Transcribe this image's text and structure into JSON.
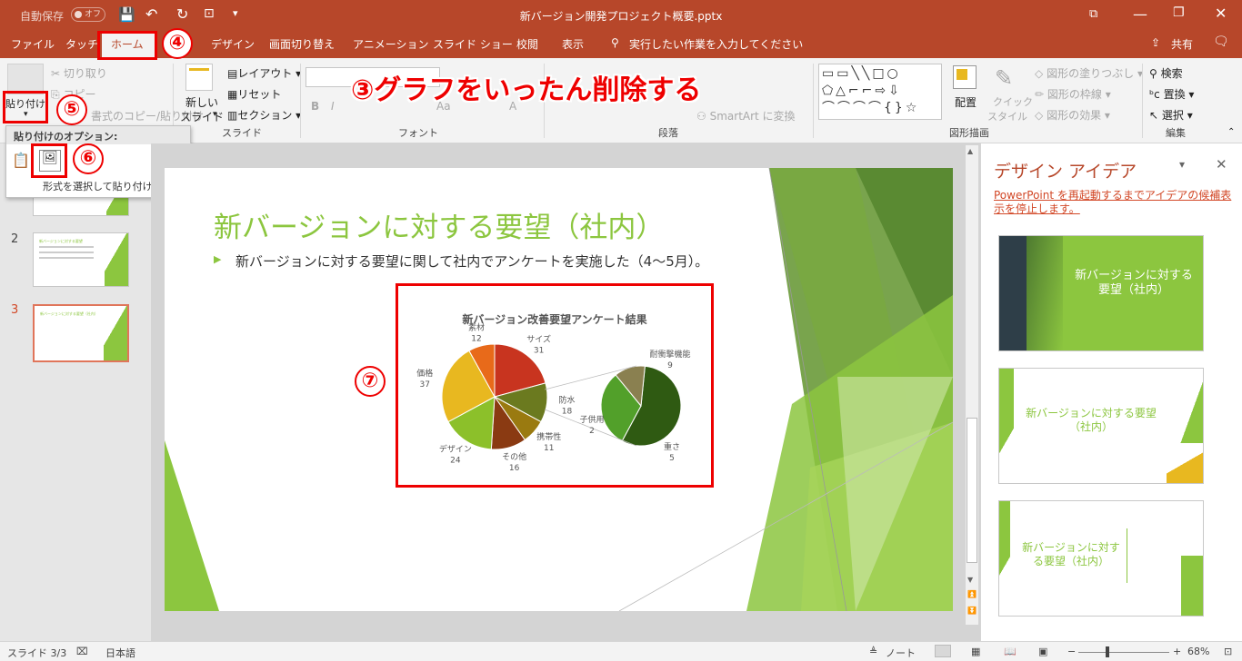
{
  "titlebar": {
    "autosave_label": "自動保存",
    "autosave_state": "オフ",
    "document_title": "新バージョン開発プロジェクト概要.pptx"
  },
  "menu": {
    "tabs": [
      "ファイル",
      "タッチ",
      "ホーム",
      "デザイン",
      "画面切り替え",
      "アニメーション",
      "スライド ショー",
      "校閲",
      "表示"
    ],
    "search_placeholder": "実行したい作業を入力してください",
    "share": "共有"
  },
  "ribbon": {
    "cut": "切り取り",
    "copy": "コピー",
    "format_painter": "書式のコピー/貼り付け",
    "paste": "貼り付け",
    "new_slide_line1": "新しい",
    "new_slide_line2": "スライド",
    "layout": "レイアウト",
    "reset": "リセット",
    "section": "セクション",
    "group_slides": "スライド",
    "group_font": "フォント",
    "group_paragraph": "段落",
    "group_drawing": "図形描画",
    "group_edit": "編集",
    "font_bold": "B",
    "font_italic": "I",
    "font_aa": "Aa",
    "font_a": "A",
    "smartart": "SmartArt に変換",
    "arrange": "配置",
    "quick_style_line1": "クイック",
    "quick_style_line2": "スタイル",
    "shape_fill": "図形の塗りつぶし",
    "shape_outline": "図形の枠線",
    "shape_effect": "図形の効果",
    "find": "検索",
    "replace": "置換",
    "select": "選択"
  },
  "paste_popup": {
    "title": "貼り付けのオプション:",
    "special": "形式を選択して貼り付け(S)..."
  },
  "annotations": {
    "step3": "③グラフをいったん削除する",
    "step4": "④",
    "step5": "⑤",
    "step6": "⑥",
    "step7": "⑦"
  },
  "thumbnails": [
    {
      "num": "2",
      "title": "新バージョンに対する要望"
    },
    {
      "num": "3",
      "title": "新バージョンに対する要望（社内）"
    }
  ],
  "slide": {
    "title": "新バージョンに対する要望（社内）",
    "bullet": "新バージョンに対する要望に関して社内でアンケートを実施した（4〜5月）。"
  },
  "chart_data": {
    "type": "pie",
    "title": "新バージョン改善要望アンケート結果",
    "categories": [
      "サイズ",
      "防水",
      "携帯性",
      "その他",
      "デザイン",
      "価格",
      "素材"
    ],
    "values": [
      31,
      18,
      11,
      16,
      24,
      37,
      12
    ],
    "colors": [
      "#c8341f",
      "#6b7a1f",
      "#9a7a10",
      "#8a3a12",
      "#8cc02a",
      "#e8b820",
      "#e86a1a"
    ],
    "sub_categories": [
      "耐衝撃機能",
      "重さ",
      "子供用"
    ],
    "sub_values": [
      9,
      5,
      2
    ],
    "sub_colors": [
      "#2f5a12",
      "#52a02a",
      "#8a8050"
    ]
  },
  "design_pane": {
    "title": "デザイン アイデア",
    "notice": "PowerPoint を再起動するまでアイデアの候補表示を停止します。",
    "idea1_title": "新バージョンに対する要望（社内）",
    "idea2_title": "新バージョンに対する要望（社内）",
    "idea3_title": "新バージョンに対する要望（社内）"
  },
  "status": {
    "slide_count": "スライド 3/3",
    "language": "日本語",
    "notes": "ノート",
    "zoom": "68%"
  },
  "colors": {
    "accent": "#b7472a",
    "green": "#8cc63f",
    "annotation_red": "#ee0000"
  }
}
